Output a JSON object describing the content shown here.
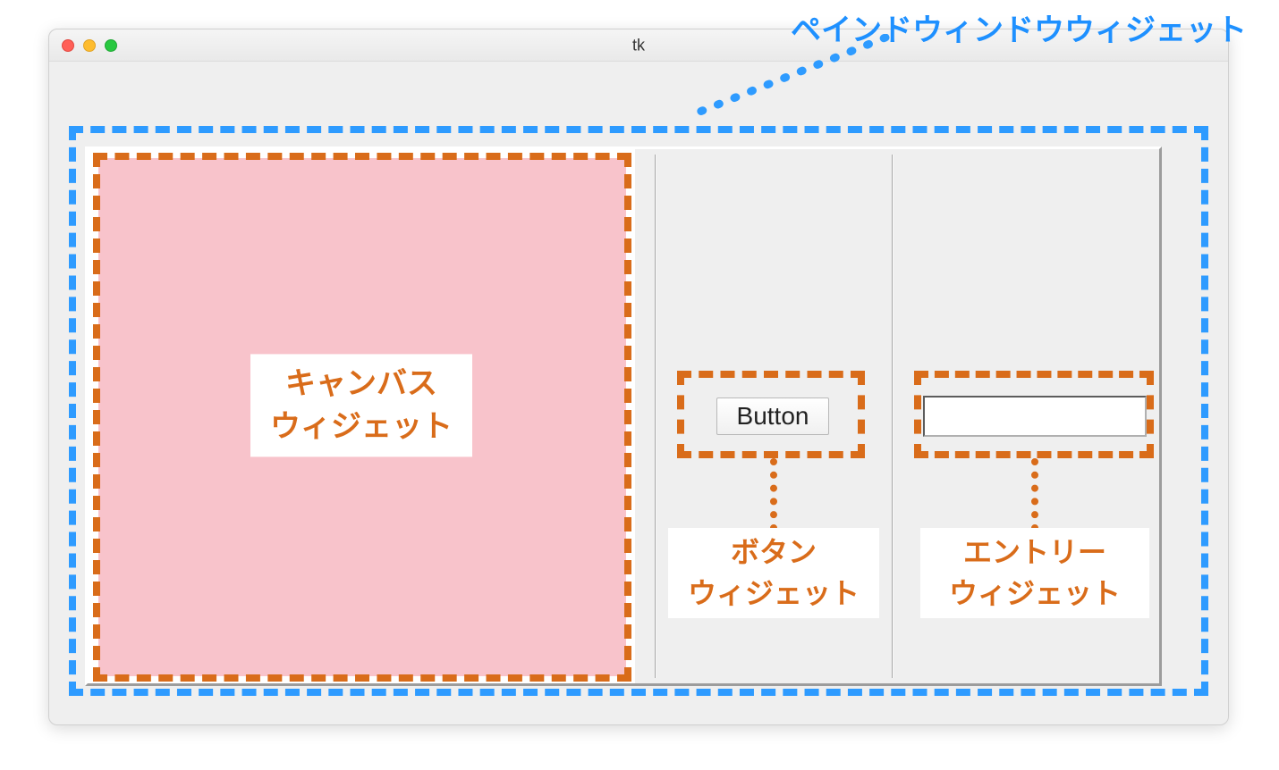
{
  "annotations": {
    "paned_window_label": "ペインドウィンドウウィジェット",
    "canvas_label_line1": "キャンバス",
    "canvas_label_line2": "ウィジェット",
    "button_label_line1": "ボタン",
    "button_label_line2": "ウィジェット",
    "entry_label_line1": "エントリー",
    "entry_label_line2": "ウィジェット"
  },
  "window": {
    "title": "tk"
  },
  "widgets": {
    "button_text": "Button",
    "entry_value": ""
  },
  "colors": {
    "annotation_blue": "#2E9BFF",
    "annotation_orange": "#D96C1A",
    "canvas_bg": "#F8C3CB",
    "window_bg": "#EFEFEF"
  }
}
